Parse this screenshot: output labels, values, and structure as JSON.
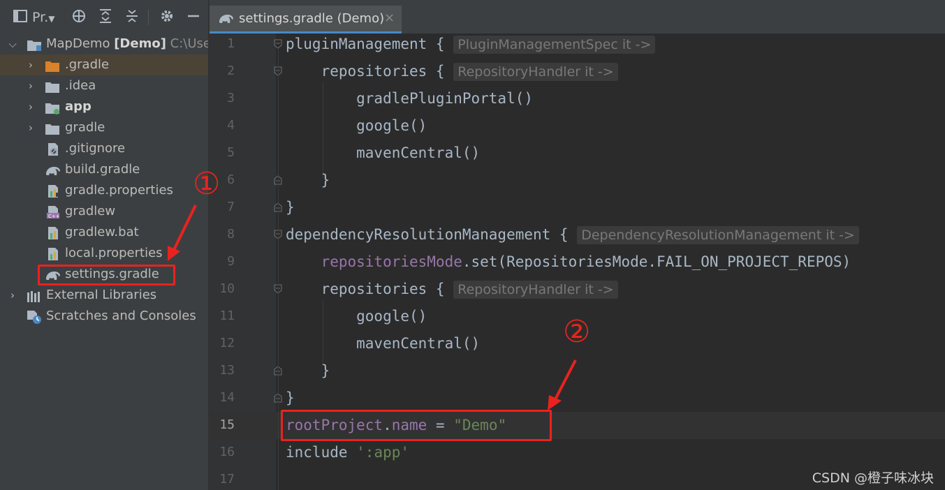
{
  "toolbar": {
    "view_label": "Pr.",
    "icons": [
      "window-icon",
      "crosshair-icon",
      "expand-all-icon",
      "collapse-all-icon",
      "gear-icon",
      "minimize-icon"
    ]
  },
  "project_tree": {
    "root_name": "MapDemo",
    "root_module": "[Demo]",
    "root_path": "C:\\User",
    "items": [
      {
        "label": ".gradle",
        "icon": "folder-orange-icon"
      },
      {
        "label": ".idea",
        "icon": "folder-icon"
      },
      {
        "label": "app",
        "icon": "module-folder-icon"
      },
      {
        "label": "gradle",
        "icon": "folder-icon"
      },
      {
        "label": ".gitignore",
        "icon": "ignore-file-icon"
      },
      {
        "label": "build.gradle",
        "icon": "gradle-elephant-icon"
      },
      {
        "label": "gradle.properties",
        "icon": "properties-file-icon"
      },
      {
        "label": "gradlew",
        "icon": "script-file-icon"
      },
      {
        "label": "gradlew.bat",
        "icon": "properties-file-icon"
      },
      {
        "label": "local.properties",
        "icon": "properties-file-icon"
      },
      {
        "label": "settings.gradle",
        "icon": "gradle-elephant-icon"
      }
    ],
    "external_libraries": "External Libraries",
    "scratches": "Scratches and Consoles"
  },
  "editor_tab": {
    "label": "settings.gradle (Demo)",
    "close": "×"
  },
  "line_numbers": [
    "1",
    "2",
    "3",
    "4",
    "5",
    "6",
    "7",
    "8",
    "9",
    "10",
    "11",
    "12",
    "13",
    "14",
    "15",
    "16",
    "17"
  ],
  "current_line": "15",
  "code": {
    "l1": "pluginManagement {",
    "l1_hint": "PluginManagementSpec it ->",
    "l2": "    repositories {",
    "l2_hint": "RepositoryHandler it ->",
    "l3": "        gradlePluginPortal()",
    "l4": "        google()",
    "l5": "        mavenCentral()",
    "l6": "    }",
    "l7": "}",
    "l8": "dependencyResolutionManagement {",
    "l8_hint": "DependencyResolutionManagement it ->",
    "l9_prop": "repositoriesMode",
    "l9_rest": ".set(RepositoriesMode.FAIL_ON_PROJECT_REPOS)",
    "l10": "    repositories {",
    "l10_hint": "RepositoryHandler it ->",
    "l11": "        google()",
    "l12": "        mavenCentral()",
    "l13": "    }",
    "l14": "}",
    "l15_obj": "rootProject",
    "l15_dot": ".",
    "l15_prop": "name",
    "l15_eq": " = ",
    "l15_str": "\"Demo\"",
    "l16_kw": "include ",
    "l16_str": "':app'"
  },
  "annotations": {
    "one": "①",
    "two": "②"
  },
  "watermark": "CSDN @橙子味冰块",
  "colors": {
    "accent": "#4a88c7",
    "annotation_red": "#e8231f",
    "selected_row": "#4b4336"
  }
}
